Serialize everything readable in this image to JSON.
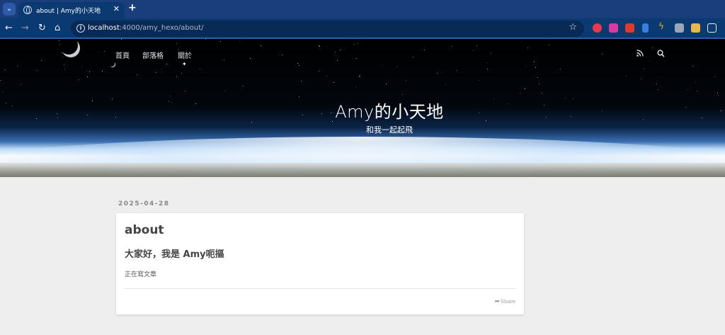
{
  "browser": {
    "tab_title": "about | Amy的小天地",
    "url_host": "localhost",
    "url_path": ":4000/amy_hexo/about/",
    "icons": [
      "tab-list-icon",
      "globe-icon",
      "close-icon",
      "plus-icon",
      "back-icon",
      "forward-icon",
      "reload-icon",
      "home-icon",
      "site-info-icon",
      "star-icon",
      "extensions-icon"
    ],
    "extension_colors": [
      "#e8384f",
      "#d93aa1",
      "#e03a2f",
      "#3b7de0",
      "#f5a623",
      "#9aa6b8",
      "#e8b84a",
      "#e6ecf5"
    ]
  },
  "header": {
    "nav": [
      "首頁",
      "部落格",
      "關於"
    ],
    "icons": [
      "rss-icon",
      "search-icon"
    ],
    "title": "Amy的小天地",
    "subtitle": "和我一起起飛"
  },
  "post": {
    "date": "2025-04-28",
    "title": "about",
    "heading": "大家好，我是 Amy呃摳",
    "body": "正在寫文章",
    "share_label": "Share"
  }
}
